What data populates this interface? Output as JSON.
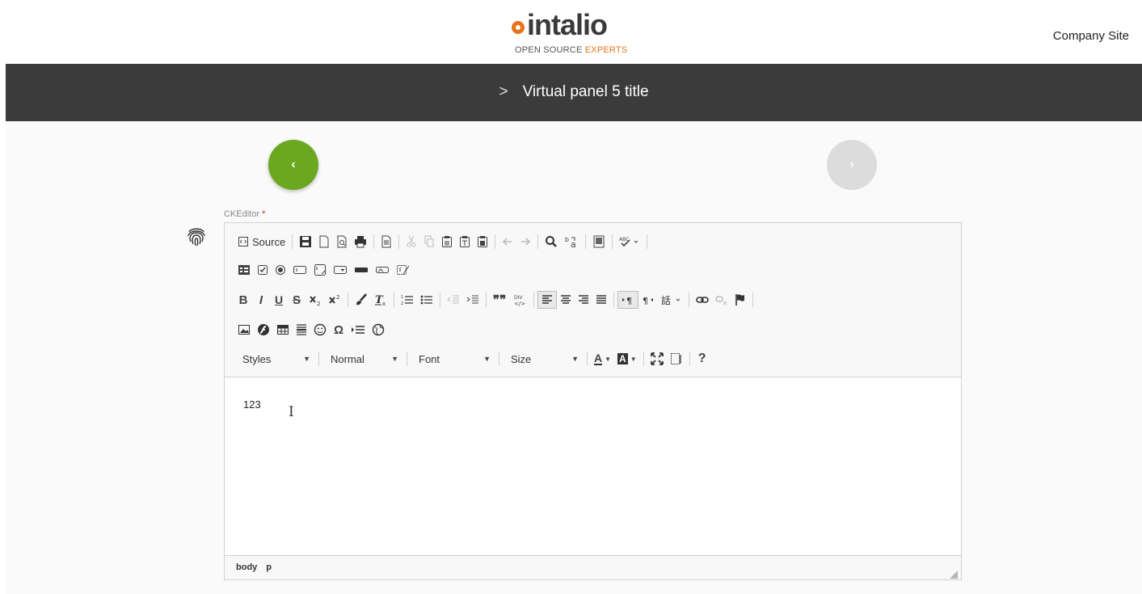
{
  "header": {
    "logo_text": "intalio",
    "logo_tagline_1": "OPEN SOURCE",
    "logo_tagline_2": "EXPERTS",
    "company_link": "Company Site"
  },
  "titlebar": {
    "chevron": ">",
    "title": "Virtual panel 5 title"
  },
  "nav": {
    "prev_icon": "chevron-left-icon",
    "next_icon": "chevron-right-icon",
    "prev_glyph": "‹",
    "next_glyph": "›"
  },
  "field": {
    "label": "CKEditor",
    "required_mark": "*"
  },
  "toolbar": {
    "source_label": "Source",
    "bold": "B",
    "italic": "I",
    "underline": "U",
    "strike": "S",
    "blockquote": "❞❞",
    "div_label": "DIV",
    "special_char": "Ω",
    "help": "?",
    "styles_combo": "Styles",
    "format_combo": "Normal",
    "font_combo": "Font",
    "size_combo": "Size",
    "text_color": "A",
    "bg_color": "A"
  },
  "editor": {
    "content": "123",
    "cursor_glyph": "I"
  },
  "statusbar": {
    "path": [
      "body",
      "p"
    ]
  },
  "colors": {
    "accent_green": "#6aa81f",
    "logo_orange": "#e8731a",
    "titlebar": "#3b3b3b",
    "disabled_nav": "#dcdcdc"
  }
}
